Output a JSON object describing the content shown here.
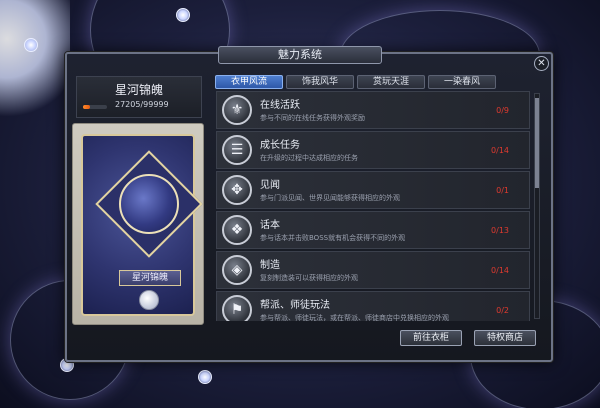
{
  "window": {
    "title": "魅力系统",
    "close_label": "✕"
  },
  "character": {
    "name": "星河锦魄",
    "progress_text": "27205/99999",
    "progress_fraction": 0.272,
    "card_label": "星河锦魄"
  },
  "tabs": [
    {
      "label": "衣甲风流",
      "active": true
    },
    {
      "label": "饰我风华",
      "active": false
    },
    {
      "label": "赏玩天涯",
      "active": false
    },
    {
      "label": "一染春风",
      "active": false
    }
  ],
  "rows": [
    {
      "icon": "mask-icon",
      "glyph": "⚜",
      "title": "在线活跃",
      "desc": "参与不同的在线任务获得外观奖励",
      "count": "0/9"
    },
    {
      "icon": "scroll-icon",
      "glyph": "☰",
      "title": "成长任务",
      "desc": "在升级的过程中达成相应的任务",
      "count": "0/14"
    },
    {
      "icon": "compass-icon",
      "glyph": "✥",
      "title": "见闻",
      "desc": "参与门派见闻、世界见闻能够获得相应的外观",
      "count": "0/1"
    },
    {
      "icon": "book-icon",
      "glyph": "❖",
      "title": "话本",
      "desc": "参与话本并击败BOSS就有机会获得不同的外观",
      "count": "0/13"
    },
    {
      "icon": "gem-icon",
      "glyph": "◈",
      "title": "制造",
      "desc": "复刻制造装可以获得相应的外观",
      "count": "0/14"
    },
    {
      "icon": "banner-icon",
      "glyph": "⚑",
      "title": "帮派、师徒玩法",
      "desc": "参与帮派、师徒玩法，或在帮派、师徒商店中兑换相应的外观",
      "count": "0/2"
    }
  ],
  "buttons": {
    "wardrobe": "前往衣柜",
    "shop": "特权商店"
  }
}
